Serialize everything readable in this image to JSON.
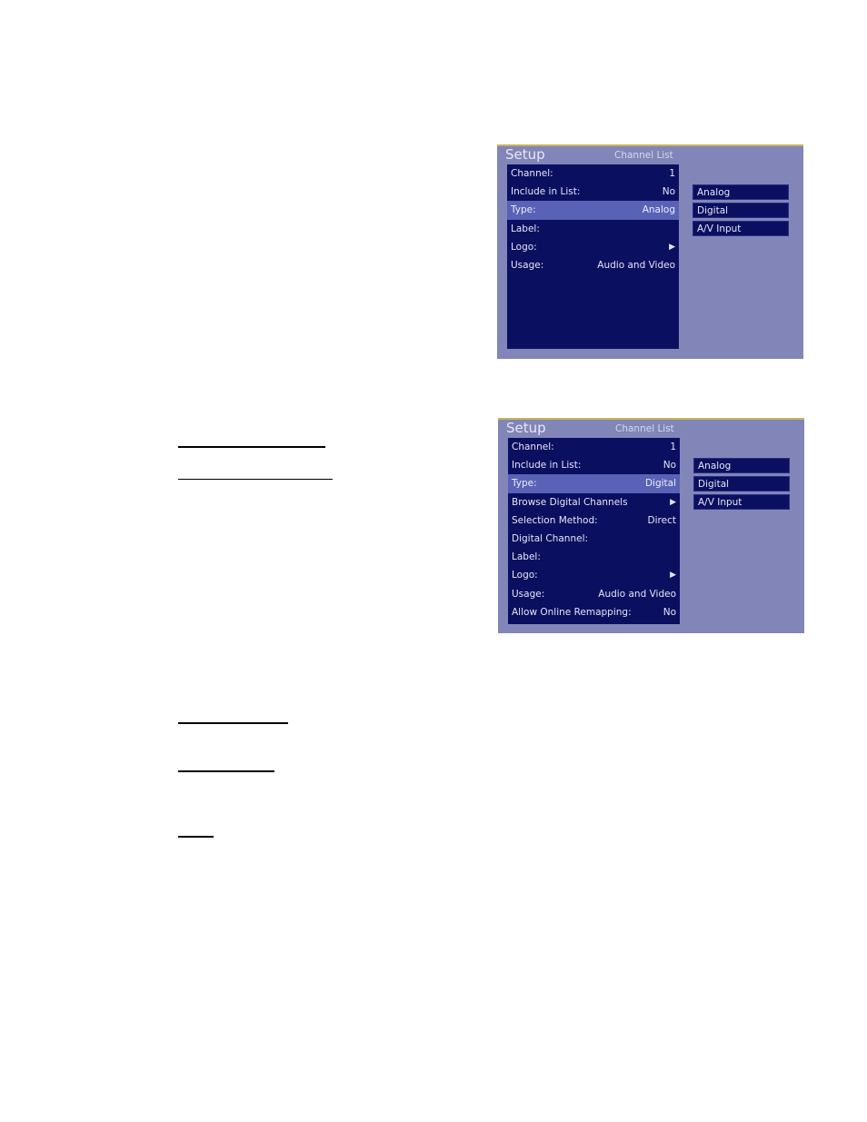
{
  "screens": [
    {
      "title": "Setup",
      "subtitle": "Channel List",
      "rows": [
        {
          "label": "Channel:",
          "value": "1"
        },
        {
          "label": "Include in List:",
          "value": "No"
        },
        {
          "label": "Type:",
          "value": "Analog",
          "selected": true
        },
        {
          "label": "Label:",
          "value": ""
        },
        {
          "label": "Logo:",
          "value": "▶"
        },
        {
          "label": "Usage:",
          "value": "Audio and Video"
        }
      ],
      "options": [
        "Analog",
        "Digital",
        "A/V Input"
      ]
    },
    {
      "title": "Setup",
      "subtitle": "Channel List",
      "rows": [
        {
          "label": "Channel:",
          "value": "1"
        },
        {
          "label": "Include in List:",
          "value": "No"
        },
        {
          "label": "Type:",
          "value": "Digital",
          "selected": true
        },
        {
          "label": "Browse Digital Channels",
          "value": "▶"
        },
        {
          "label": "Selection Method:",
          "value": "Direct"
        },
        {
          "label": "Digital Channel:",
          "value": ""
        },
        {
          "label": "Label:",
          "value": ""
        },
        {
          "label": "Logo:",
          "value": "▶"
        },
        {
          "label": "Usage:",
          "value": "Audio and Video"
        },
        {
          "label": "Allow Online Remapping:",
          "value": "No"
        }
      ],
      "options": [
        "Analog",
        "Digital",
        "A/V Input"
      ]
    }
  ]
}
